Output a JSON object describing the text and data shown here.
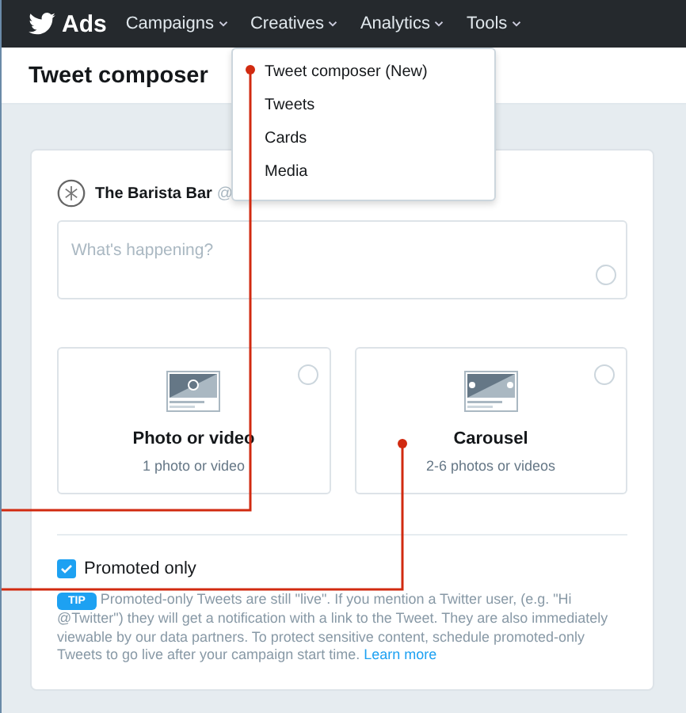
{
  "nav": {
    "brand": "Ads",
    "items": [
      {
        "label": "Campaigns"
      },
      {
        "label": "Creatives"
      },
      {
        "label": "Analytics"
      },
      {
        "label": "Tools"
      }
    ]
  },
  "menu": {
    "items": [
      {
        "label": "Tweet composer (New)"
      },
      {
        "label": "Tweets"
      },
      {
        "label": "Cards"
      },
      {
        "label": "Media"
      }
    ]
  },
  "page_title": "Tweet composer",
  "composer": {
    "account": "The Barista Bar",
    "handle": "@",
    "placeholder": "What's happening?",
    "media_options": [
      {
        "kind": "photo",
        "title": "Photo or video",
        "caption": "1 photo or video",
        "selected": false
      },
      {
        "kind": "carousel",
        "title": "Carousel",
        "caption": "2-6 photos or videos",
        "selected": false
      }
    ],
    "promoted_only": {
      "label": "Promoted only",
      "checked": true
    },
    "tip": {
      "badge": "TIP",
      "text": "Promoted-only Tweets are still \"live\". If you mention a Twitter user, (e.g. \"Hi @Twitter\") they will get a notification with a link to the Tweet. They are also immediately viewable by our data partners. To protect sensitive content, schedule promoted-only Tweets to go live after your campaign start time.",
      "link": "Learn more"
    }
  }
}
